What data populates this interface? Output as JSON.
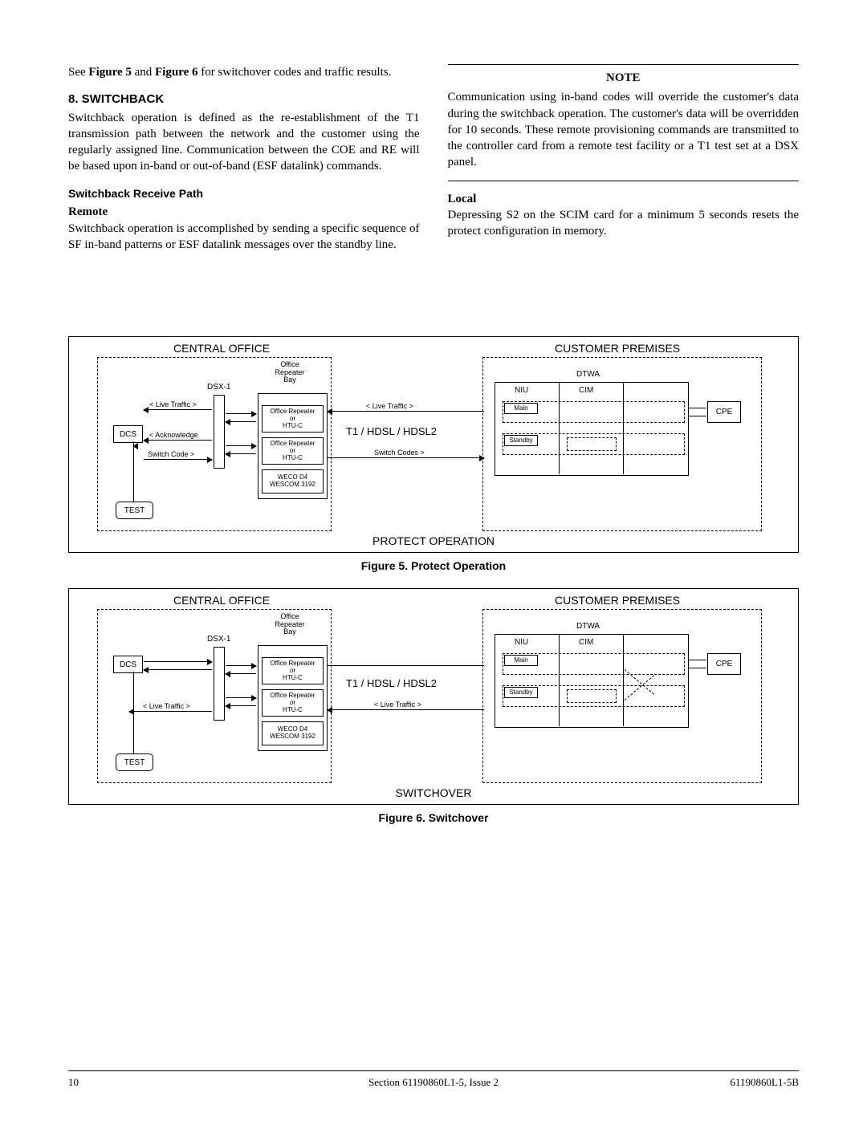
{
  "intro": {
    "see_pre": "See ",
    "fig5_ref": "Figure 5",
    "and": " and ",
    "fig6_ref": "Figure 6",
    "see_post": " for switchover codes and traffic results."
  },
  "section8": {
    "heading": "8.  SWITCHBACK",
    "body": "Switchback operation is defined as the re-establishment of the T1 transmission path between the network and the customer using the regularly assigned line.  Communication between the COE and RE will be based upon in-band or out-of-band (ESF datalink) commands."
  },
  "receive_path": {
    "heading": "Switchback Receive Path",
    "remote_label": "Remote",
    "remote_body": "Switchback operation is accomplished by sending a specific sequence of SF in-band patterns or ESF datalink messages over the standby line."
  },
  "note": {
    "title": "NOTE",
    "body": "Communication using in-band codes will override the customer's data during the switchback operation.  The customer's data will be overridden for 10 seconds.  These remote provisioning commands are transmitted to the controller card from a remote test facility or a T1 test set at a DSX panel."
  },
  "local": {
    "label": "Local",
    "body": "Depressing S2 on the SCIM card for a minimum 5 seconds resets the protect configuration in memory."
  },
  "diagram": {
    "central_office": "CENTRAL OFFICE",
    "customer_premises": "CUSTOMER PREMISES",
    "office_repeater_bay": "Office\nRepeater\nBay",
    "dsx1": "DSX-1",
    "dcs": "DCS",
    "test": "TEST",
    "office_repeater_htuc": "Office Repeater\nor\nHTU-C",
    "weco": "WECO D4\nWESCOM 3192",
    "t1_hdsl": "T1 / HDSL / HDSL2",
    "dtwa": "DTWA",
    "niu": "NIU",
    "cim": "CIM",
    "main": "Main",
    "standby": "Standby",
    "cpe": "CPE",
    "live_traffic": "< Live Traffic >",
    "acknowledge": "< Acknowledge",
    "switch_code": "Switch Code >",
    "switch_codes": "Switch Codes >",
    "protect_operation": "PROTECT OPERATION",
    "switchover": "SWITCHOVER"
  },
  "captions": {
    "fig5": "Figure 5.  Protect Operation",
    "fig6": "Figure 6.  Switchover"
  },
  "footer": {
    "left": "10",
    "center": "Section 61190860L1-5, Issue 2",
    "right": "61190860L1-5B"
  }
}
